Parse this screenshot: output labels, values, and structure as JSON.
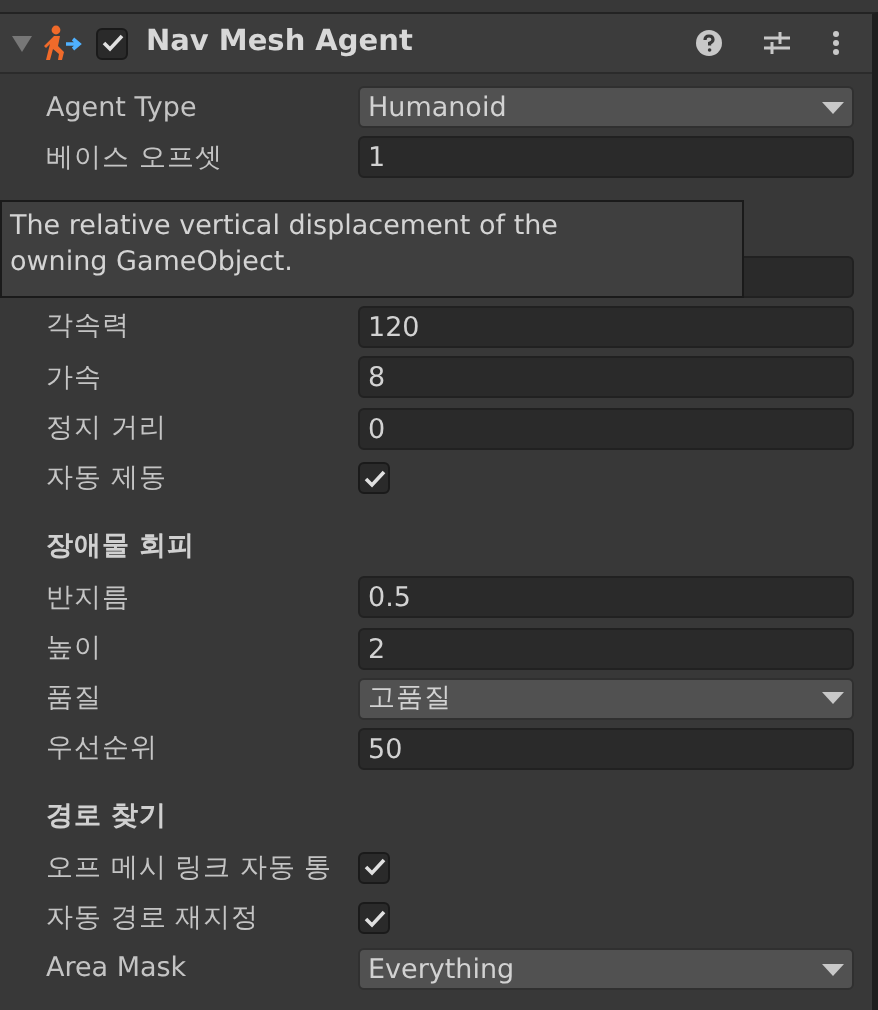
{
  "component": {
    "title": "Nav Mesh Agent",
    "enabled": true,
    "expanded": true
  },
  "items": [
    {
      "kind": "dropdown",
      "label": "Agent Type",
      "value": "Humanoid"
    },
    {
      "kind": "field",
      "label": "베이스 오프셋",
      "value": "1"
    },
    {
      "kind": "hidden_header"
    },
    {
      "kind": "hidden_field"
    },
    {
      "kind": "field",
      "label": "각속력",
      "value": "120"
    },
    {
      "kind": "field",
      "label": "가속",
      "value": "8"
    },
    {
      "kind": "field",
      "label": "정지 거리",
      "value": "0"
    },
    {
      "kind": "checkbox",
      "label": "자동 제동",
      "checked": true
    },
    {
      "kind": "header",
      "label": "장애물 회피"
    },
    {
      "kind": "field",
      "label": "반지름",
      "value": "0.5"
    },
    {
      "kind": "field",
      "label": "높이",
      "value": "2"
    },
    {
      "kind": "dropdown",
      "label": "품질",
      "value": "고품질"
    },
    {
      "kind": "field",
      "label": "우선순위",
      "value": "50"
    },
    {
      "kind": "header",
      "label": "경로 찾기"
    },
    {
      "kind": "checkbox",
      "label": "오프 메시 링크 자동 통",
      "checked": true
    },
    {
      "kind": "checkbox",
      "label": "자동 경로 재지정",
      "checked": true
    },
    {
      "kind": "dropdown",
      "label": "Area Mask",
      "value": "Everything"
    }
  ],
  "tooltip": {
    "text": "The relative vertical displacement of the owning GameObject."
  }
}
